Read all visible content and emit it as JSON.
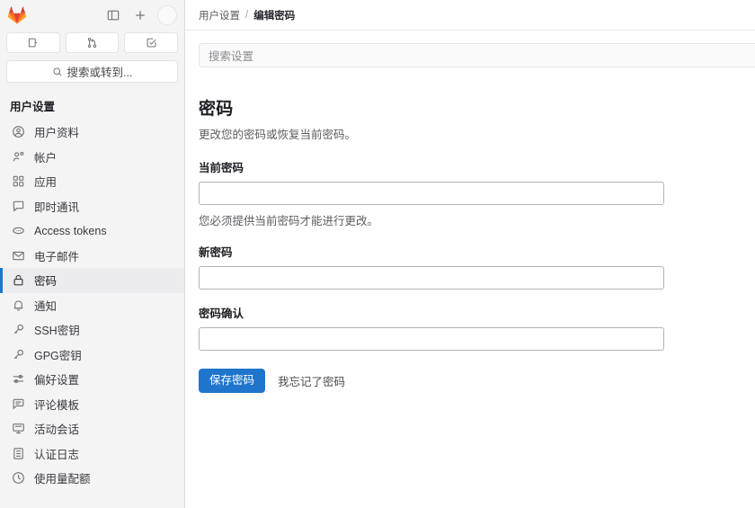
{
  "sidebar": {
    "logo_name": "gitlab-logo",
    "top_actions": [
      {
        "name": "toggle-sidebar-button",
        "icon": "panel-icon"
      },
      {
        "name": "create-new-button",
        "icon": "plus-icon"
      },
      {
        "name": "user-avatar",
        "icon": "avatar-icon"
      }
    ],
    "quick_buttons": [
      {
        "name": "issues-button",
        "icon": "issues-icon"
      },
      {
        "name": "merge-requests-button",
        "icon": "merge-request-icon"
      },
      {
        "name": "todo-list-button",
        "icon": "todo-check-icon"
      }
    ],
    "search": {
      "label": "搜索或转到...",
      "icon": "search-icon"
    },
    "section_title": "用户设置",
    "items": [
      {
        "label": "用户资料",
        "icon": "user-circle-icon",
        "active": false
      },
      {
        "label": "帐户",
        "icon": "user-settings-icon",
        "active": false
      },
      {
        "label": "应用",
        "icon": "applications-grid-icon",
        "active": false
      },
      {
        "label": "即时通讯",
        "icon": "chat-bubble-icon",
        "active": false
      },
      {
        "label": "Access tokens",
        "icon": "token-icon",
        "active": false
      },
      {
        "label": "电子邮件",
        "icon": "envelope-icon",
        "active": false
      },
      {
        "label": "密码",
        "icon": "lock-icon",
        "active": true
      },
      {
        "label": "通知",
        "icon": "bell-icon",
        "active": false
      },
      {
        "label": "SSH密钥",
        "icon": "key-icon",
        "active": false
      },
      {
        "label": "GPG密钥",
        "icon": "key-icon",
        "active": false
      },
      {
        "label": "偏好设置",
        "icon": "preferences-sliders-icon",
        "active": false
      },
      {
        "label": "评论模板",
        "icon": "comment-icon",
        "active": false
      },
      {
        "label": "活动会话",
        "icon": "monitor-icon",
        "active": false
      },
      {
        "label": "认证日志",
        "icon": "log-list-icon",
        "active": false
      },
      {
        "label": "使用量配额",
        "icon": "clock-icon",
        "active": false
      }
    ]
  },
  "breadcrumb": {
    "parent": "用户设置",
    "separator": "/",
    "current": "编辑密码"
  },
  "settings_search": {
    "placeholder": "搜索设置"
  },
  "page": {
    "title": "密码",
    "description": "更改您的密码或恢复当前密码。"
  },
  "form": {
    "current_password": {
      "label": "当前密码",
      "value": "",
      "placeholder": "",
      "help": "您必须提供当前密码才能进行更改。"
    },
    "new_password": {
      "label": "新密码",
      "value": "",
      "placeholder": ""
    },
    "confirm_password": {
      "label": "密码确认",
      "value": "",
      "placeholder": ""
    },
    "submit_label": "保存密码",
    "forgot_label": "我忘记了密码"
  },
  "colors": {
    "accent": "#1f75cb",
    "sidebar_bg": "#f4f4f4",
    "active_item_bg": "#ececef",
    "logo_orange": "#e24329",
    "logo_light": "#fc6d26"
  }
}
